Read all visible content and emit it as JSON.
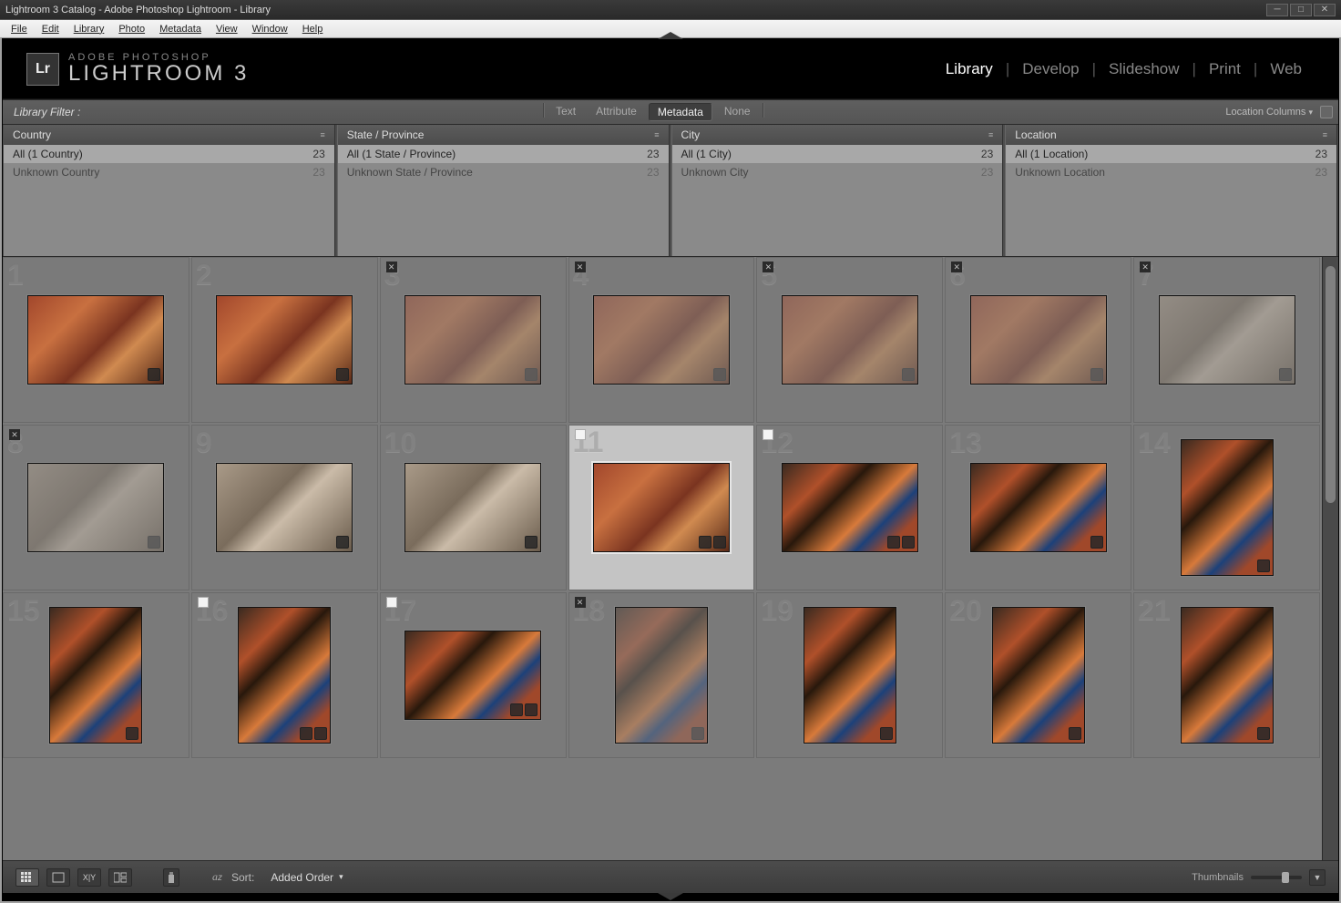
{
  "window": {
    "title": "Lightroom 3 Catalog - Adobe Photoshop Lightroom - Library"
  },
  "menu": {
    "file": "File",
    "edit": "Edit",
    "library": "Library",
    "photo": "Photo",
    "metadata": "Metadata",
    "view": "View",
    "window": "Window",
    "help": "Help"
  },
  "branding": {
    "badge": "Lr",
    "line1": "ADOBE PHOTOSHOP",
    "line2": "LIGHTROOM 3"
  },
  "modules": {
    "library": "Library",
    "develop": "Develop",
    "slideshow": "Slideshow",
    "print": "Print",
    "web": "Web",
    "active": "library"
  },
  "filterBar": {
    "label": "Library Filter :",
    "tabs": {
      "text": "Text",
      "attribute": "Attribute",
      "metadata": "Metadata",
      "none": "None",
      "active": "metadata"
    },
    "right": "Location Columns"
  },
  "filterCols": [
    {
      "header": "Country",
      "rows": [
        {
          "label": "All (1 Country)",
          "count": 23,
          "sel": true
        },
        {
          "label": "Unknown Country",
          "count": 23,
          "sel": false
        }
      ]
    },
    {
      "header": "State / Province",
      "rows": [
        {
          "label": "All (1 State / Province)",
          "count": 23,
          "sel": true
        },
        {
          "label": "Unknown State / Province",
          "count": 23,
          "sel": false
        }
      ]
    },
    {
      "header": "City",
      "rows": [
        {
          "label": "All (1 City)",
          "count": 23,
          "sel": true
        },
        {
          "label": "Unknown City",
          "count": 23,
          "sel": false
        }
      ]
    },
    {
      "header": "Location",
      "rows": [
        {
          "label": "All (1 Location)",
          "count": 23,
          "sel": true
        },
        {
          "label": "Unknown Location",
          "count": 23,
          "sel": false
        }
      ]
    }
  ],
  "thumbs": [
    {
      "n": 1,
      "orient": "l",
      "look": "leaves",
      "flag": "",
      "dim": false,
      "sel": false,
      "badges": 1
    },
    {
      "n": 2,
      "orient": "l",
      "look": "leaves",
      "flag": "",
      "dim": false,
      "sel": false,
      "badges": 1
    },
    {
      "n": 3,
      "orient": "l",
      "look": "leaves",
      "flag": "x",
      "dim": true,
      "sel": false,
      "badges": 1
    },
    {
      "n": 4,
      "orient": "l",
      "look": "leaves",
      "flag": "x",
      "dim": true,
      "sel": false,
      "badges": 1
    },
    {
      "n": 5,
      "orient": "l",
      "look": "leaves",
      "flag": "x",
      "dim": true,
      "sel": false,
      "badges": 1
    },
    {
      "n": 6,
      "orient": "l",
      "look": "leaves",
      "flag": "x",
      "dim": true,
      "sel": false,
      "badges": 1
    },
    {
      "n": 7,
      "orient": "l",
      "look": "bark",
      "flag": "x",
      "dim": true,
      "sel": false,
      "badges": 1
    },
    {
      "n": 8,
      "orient": "l",
      "look": "bark",
      "flag": "x",
      "dim": true,
      "sel": false,
      "badges": 1
    },
    {
      "n": 9,
      "orient": "l",
      "look": "bark",
      "flag": "",
      "dim": false,
      "sel": false,
      "badges": 1
    },
    {
      "n": 10,
      "orient": "l",
      "look": "bark",
      "flag": "",
      "dim": false,
      "sel": false,
      "badges": 1
    },
    {
      "n": 11,
      "orient": "l",
      "look": "leaves",
      "flag": "p",
      "dim": false,
      "sel": true,
      "badges": 2
    },
    {
      "n": 12,
      "orient": "l",
      "look": "canopy",
      "flag": "p",
      "dim": false,
      "sel": false,
      "badges": 2
    },
    {
      "n": 13,
      "orient": "l",
      "look": "canopy",
      "flag": "",
      "dim": false,
      "sel": false,
      "badges": 1
    },
    {
      "n": 14,
      "orient": "p",
      "look": "canopy",
      "flag": "",
      "dim": false,
      "sel": false,
      "badges": 1
    },
    {
      "n": 15,
      "orient": "p",
      "look": "canopy",
      "flag": "",
      "dim": false,
      "sel": false,
      "badges": 1
    },
    {
      "n": 16,
      "orient": "p",
      "look": "canopy",
      "flag": "p",
      "dim": false,
      "sel": false,
      "badges": 2
    },
    {
      "n": 17,
      "orient": "l",
      "look": "canopy",
      "flag": "p",
      "dim": false,
      "sel": false,
      "badges": 2
    },
    {
      "n": 18,
      "orient": "p",
      "look": "canopy",
      "flag": "x",
      "dim": true,
      "sel": false,
      "badges": 1
    },
    {
      "n": 19,
      "orient": "p",
      "look": "canopy",
      "flag": "",
      "dim": false,
      "sel": false,
      "badges": 1
    },
    {
      "n": 20,
      "orient": "p",
      "look": "canopy",
      "flag": "",
      "dim": false,
      "sel": false,
      "badges": 1
    },
    {
      "n": 21,
      "orient": "p",
      "look": "canopy",
      "flag": "",
      "dim": false,
      "sel": false,
      "badges": 1
    }
  ],
  "toolbar": {
    "sortLabel": "Sort:",
    "sortValue": "Added Order",
    "thumbnails": "Thumbnails"
  }
}
